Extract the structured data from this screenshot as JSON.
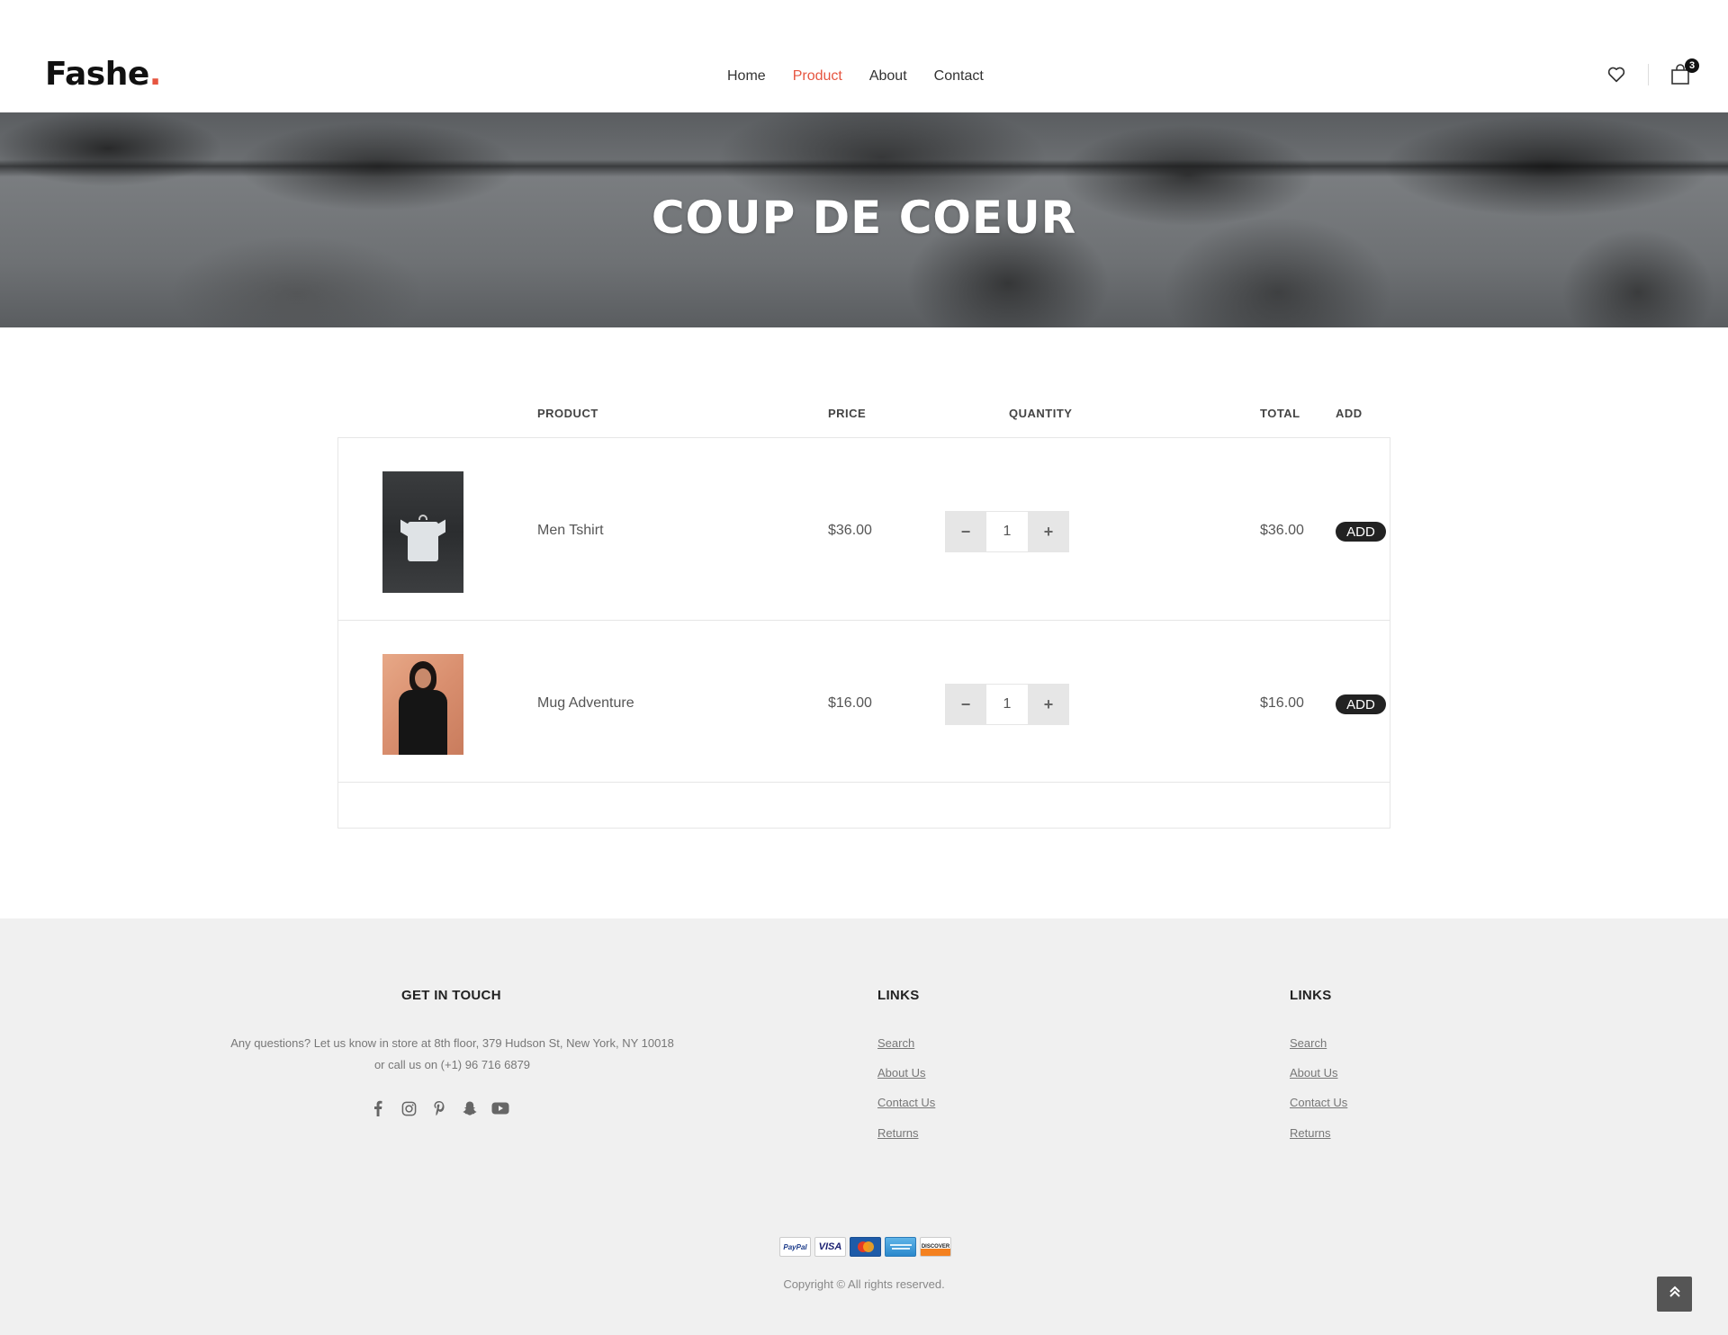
{
  "header": {
    "logo_text": "Fashe",
    "logo_dot": ".",
    "nav": [
      {
        "label": "Home",
        "active": false
      },
      {
        "label": "Product",
        "active": true
      },
      {
        "label": "About",
        "active": false
      },
      {
        "label": "Contact",
        "active": false
      }
    ],
    "cart_count": "3",
    "icons": {
      "wishlist": "heart-icon",
      "cart": "shopping-bag-icon"
    }
  },
  "hero": {
    "title": "COUP DE COEUR"
  },
  "cart": {
    "columns": {
      "product": "PRODUCT",
      "price": "PRICE",
      "quantity": "QUANTITY",
      "total": "TOTAL",
      "add": "ADD"
    },
    "rows": [
      {
        "name": "Men Tshirt",
        "price": "$36.00",
        "quantity": "1",
        "total": "$36.00",
        "add_label": "ADD"
      },
      {
        "name": "Mug Adventure",
        "price": "$16.00",
        "quantity": "1",
        "total": "$16.00",
        "add_label": "ADD"
      }
    ],
    "minus_symbol": "−",
    "plus_symbol": "+"
  },
  "footer": {
    "get_in_touch": {
      "title": "GET IN TOUCH",
      "text": "Any questions? Let us know in store at 8th floor, 379 Hudson St, New York, NY 10018 or call us on (+1) 96 716 6879",
      "social": [
        "facebook-icon",
        "instagram-icon",
        "pinterest-icon",
        "snapchat-icon",
        "youtube-icon"
      ]
    },
    "links_1": {
      "title": "LINKS",
      "items": [
        "Search",
        "About Us",
        "Contact Us",
        "Returns"
      ]
    },
    "links_2": {
      "title": "LINKS",
      "items": [
        "Search",
        "About Us",
        "Contact Us",
        "Returns"
      ]
    },
    "payments": [
      "PayPal",
      "VISA",
      "",
      "",
      "DISCOVER"
    ],
    "copyright": "Copyright © All rights reserved."
  },
  "colors": {
    "accent": "#e65540",
    "dark": "#222222",
    "footer_bg": "#f0f0f0"
  }
}
